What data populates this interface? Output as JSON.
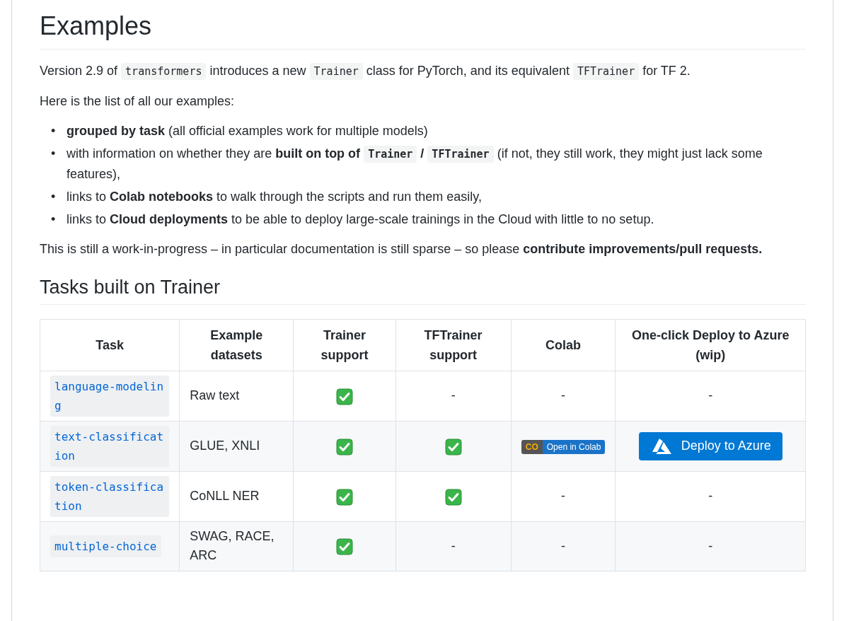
{
  "title": "Examples",
  "intro": [
    {
      "kind": "text",
      "text": "Version 2.9 of "
    },
    {
      "kind": "code",
      "text": "transformers"
    },
    {
      "kind": "text",
      "text": " introduces a new "
    },
    {
      "kind": "code",
      "text": "Trainer"
    },
    {
      "kind": "text",
      "text": " class for PyTorch, and its equivalent "
    },
    {
      "kind": "code",
      "text": "TFTrainer"
    },
    {
      "kind": "text",
      "text": " for TF 2."
    }
  ],
  "list_intro": "Here is the list of all our examples:",
  "bullets": [
    {
      "marker": "•",
      "segments": [
        {
          "kind": "bold",
          "text": "grouped by task"
        },
        {
          "kind": "text",
          "text": " (all official examples work for multiple models)"
        }
      ]
    },
    {
      "marker": "•",
      "segments": [
        {
          "kind": "text",
          "text": "with information on whether they are "
        },
        {
          "kind": "bold",
          "text": "built on top of "
        },
        {
          "kind": "boldcode",
          "text": "Trainer"
        },
        {
          "kind": "bold",
          "text": " / "
        },
        {
          "kind": "boldcode",
          "text": "TFTrainer"
        },
        {
          "kind": "text",
          "text": " (if not, they still work, they might just lack some features),"
        }
      ]
    },
    {
      "marker": "•",
      "segments": [
        {
          "kind": "text",
          "text": "links to "
        },
        {
          "kind": "bold",
          "text": "Colab notebooks"
        },
        {
          "kind": "text",
          "text": " to walk through the scripts and run them easily,"
        }
      ]
    },
    {
      "marker": "•",
      "segments": [
        {
          "kind": "text",
          "text": "links to "
        },
        {
          "kind": "bold",
          "text": "Cloud deployments"
        },
        {
          "kind": "text",
          "text": " to be able to deploy large-scale trainings in the Cloud with little to no setup."
        }
      ]
    }
  ],
  "note": [
    {
      "kind": "text",
      "text": "This is still a work-in-progress – in particular documentation is still sparse – so please "
    },
    {
      "kind": "bold",
      "text": "contribute improvements/pull requests."
    }
  ],
  "section_title": "Tasks built on Trainer",
  "table": {
    "columns": [
      "Task",
      "Example datasets",
      "Trainer support",
      "TFTrainer support",
      "Colab",
      "One-click Deploy to Azure (wip)"
    ],
    "rows": [
      [
        {
          "kind": "code",
          "text": "language-modeling"
        },
        {
          "kind": "text",
          "text": "Raw text"
        },
        {
          "kind": "check"
        },
        {
          "kind": "text",
          "text": "-"
        },
        {
          "kind": "text",
          "text": "-"
        },
        {
          "kind": "text",
          "text": "-"
        }
      ],
      [
        {
          "kind": "code",
          "text": "text-classification"
        },
        {
          "kind": "text",
          "text": "GLUE, XNLI"
        },
        {
          "kind": "check"
        },
        {
          "kind": "check"
        },
        {
          "kind": "colab",
          "logo": "CO",
          "text": "Open in Colab"
        },
        {
          "kind": "azure",
          "text": "Deploy to Azure"
        }
      ],
      [
        {
          "kind": "code",
          "text": "token-classification"
        },
        {
          "kind": "text",
          "text": "CoNLL NER"
        },
        {
          "kind": "check"
        },
        {
          "kind": "check"
        },
        {
          "kind": "text",
          "text": "-"
        },
        {
          "kind": "text",
          "text": "-"
        }
      ],
      [
        {
          "kind": "code",
          "text": "multiple-choice"
        },
        {
          "kind": "text",
          "text": "SWAG, RACE, ARC"
        },
        {
          "kind": "check"
        },
        {
          "kind": "text",
          "text": "-"
        },
        {
          "kind": "text",
          "text": "-"
        },
        {
          "kind": "text",
          "text": "-"
        }
      ]
    ]
  }
}
